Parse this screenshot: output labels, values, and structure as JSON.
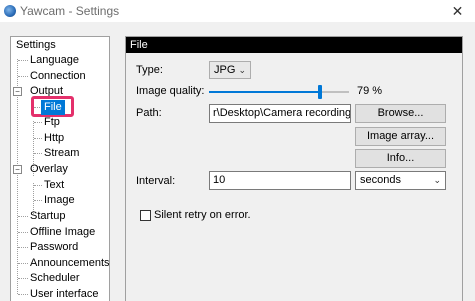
{
  "window": {
    "title": "Yawcam - Settings",
    "close_glyph": "✕"
  },
  "tree": {
    "items": [
      {
        "label": "Settings"
      },
      {
        "label": "Language"
      },
      {
        "label": "Connection"
      },
      {
        "label": "Output",
        "expanded": true
      },
      {
        "label": "File",
        "selected": true
      },
      {
        "label": "Ftp"
      },
      {
        "label": "Http"
      },
      {
        "label": "Stream"
      },
      {
        "label": "Overlay",
        "expanded": true
      },
      {
        "label": "Text"
      },
      {
        "label": "Image"
      },
      {
        "label": "Startup"
      },
      {
        "label": "Offline Image"
      },
      {
        "label": "Password"
      },
      {
        "label": "Announcements"
      },
      {
        "label": "Scheduler"
      },
      {
        "label": "User interface"
      }
    ],
    "collapse_glyph": "−"
  },
  "panel": {
    "header": "File",
    "type_label": "Type:",
    "type_value": "JPG",
    "quality_label": "Image quality:",
    "quality_value": "79 %",
    "quality_level": 0.79,
    "path_label": "Path:",
    "path_value": "r\\Desktop\\Camera recordings",
    "browse_button": "Browse...",
    "image_array_button": "Image array...",
    "info_button": "Info...",
    "interval_label": "Interval:",
    "interval_value": "10",
    "interval_unit": "seconds",
    "silent_retry_label": "Silent retry on error.",
    "silent_retry_checked": false
  },
  "colors": {
    "selection": "#0078d7",
    "highlight_box": "#e4306b"
  }
}
